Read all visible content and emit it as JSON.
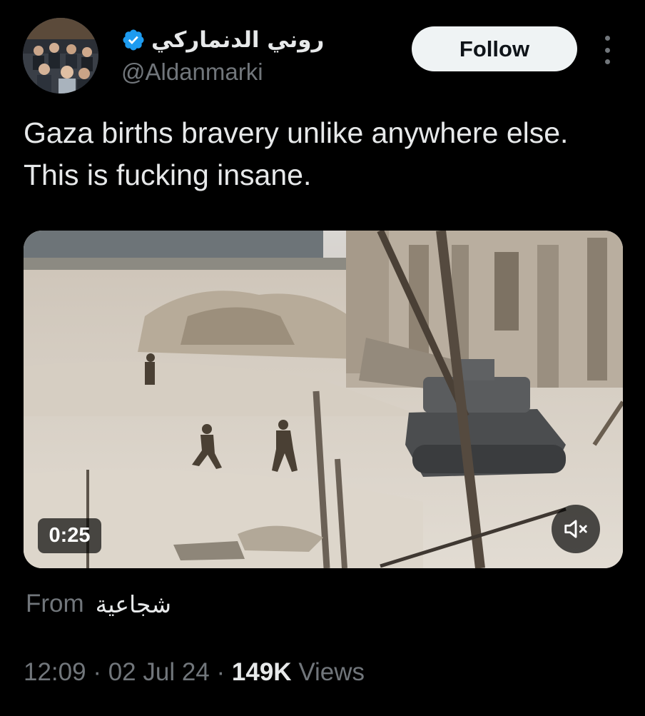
{
  "author": {
    "display_name": "روني الدنماركي",
    "handle": "@Aldanmarki",
    "verified": true
  },
  "actions": {
    "follow_label": "Follow"
  },
  "tweet": {
    "text": "Gaza births bravery unlike anywhere else. This is fucking insane."
  },
  "media": {
    "duration": "0:25",
    "muted": true
  },
  "source": {
    "from_label": "From",
    "name": "شجاعية"
  },
  "meta": {
    "time": "12:09",
    "date": "02 Jul 24",
    "separator": "·",
    "views_count": "149K",
    "views_label": "Views"
  },
  "colors": {
    "background": "#000000",
    "text_primary": "#e7e9ea",
    "text_secondary": "#71767b",
    "verified_badge": "#1d9bf0",
    "follow_bg": "#eff3f4"
  }
}
